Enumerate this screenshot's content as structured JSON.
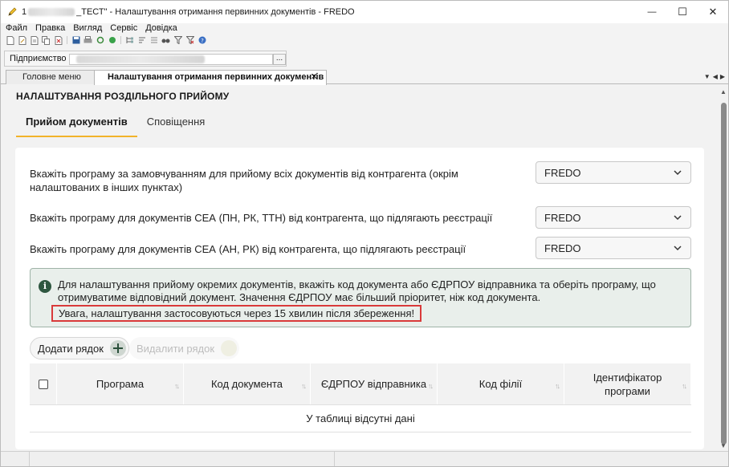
{
  "window": {
    "title_prefix": "1",
    "title_suffix": "_ТЕСТ\" - Налаштування отримання первинних документів - FREDO",
    "minimize": "—",
    "maximize": "☐",
    "close": "✕"
  },
  "menu": [
    "Файл",
    "Правка",
    "Вигляд",
    "Сервіс",
    "Довідка"
  ],
  "enterprise": {
    "label": "Підприємство",
    "browse": "..."
  },
  "tabs": [
    {
      "label": "Головне меню"
    },
    {
      "label": "Налаштування отримання первинних документів",
      "close": "✕"
    }
  ],
  "page": {
    "title": "НАЛАШТУВАННЯ РОЗДІЛЬНОГО ПРИЙОМУ",
    "inner_tabs": [
      "Прийом документів",
      "Сповіщення"
    ]
  },
  "settings": [
    {
      "label": "Вкажіть програму за замовчуванням для прийому всіх документів від контрагента (окрім налаштованих в інших пунктах)",
      "value": "FREDO"
    },
    {
      "label": "Вкажіть програму для документів СЕА (ПН, РК, ТТН) від контрагента, що підлягають реєстрації",
      "value": "FREDO"
    },
    {
      "label": "Вкажіть програму для документів СЕА (АН, РК) від контрагента, що підлягають реєстрації",
      "value": "FREDO"
    }
  ],
  "info": {
    "icon": "i",
    "text": "Для налаштування прийому окремих документів, вкажіть код документа або ЄДРПОУ відправника та оберіть програму, що отримуватиме відповідний документ. Значення ЄДРПОУ має більший пріоритет, ніж код документа.",
    "warning": "Увага, налаштування застосовуються через 15 хвилин після збереження!"
  },
  "actions": {
    "add_row": "Додати рядок",
    "delete_row": "Видалити рядок"
  },
  "table": {
    "columns": [
      "Програма",
      "Код документа",
      "ЄДРПОУ відправника",
      "Код філії",
      "Ідентифікатор програми"
    ],
    "sort_glyph": "↑↓",
    "empty_text": "У таблиці відсутні дані"
  },
  "colors": {
    "accent_underline": "#f2b32a",
    "info_icon_bg": "#2e5740",
    "warning_border": "#d93a3a"
  }
}
